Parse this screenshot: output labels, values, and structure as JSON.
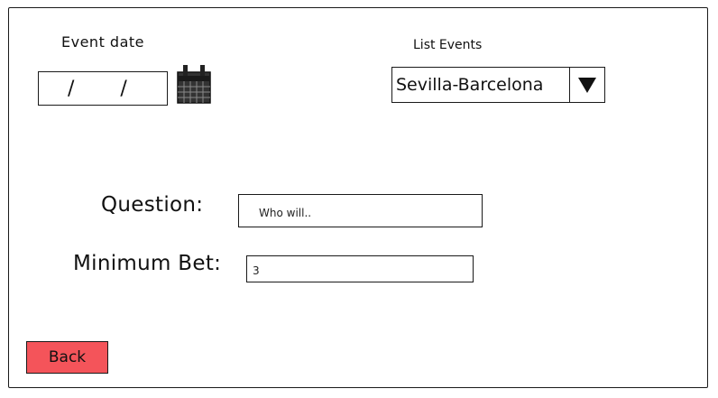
{
  "event_date": {
    "label": "Event date",
    "value": "/ /"
  },
  "list_events": {
    "label": "List Events",
    "selected": "Sevilla-Barcelona"
  },
  "question": {
    "label": "Question:",
    "value": "Who will.."
  },
  "minimum_bet": {
    "label": "Minimum Bet:",
    "value": "3"
  },
  "back_button": {
    "label": "Back"
  },
  "colors": {
    "back_button_bg": "#f4545a",
    "outline": "#1a1a1a",
    "calendar_icon": "#333333"
  },
  "icons": {
    "calendar": "calendar-icon",
    "dropdown": "triangle-down-icon"
  }
}
